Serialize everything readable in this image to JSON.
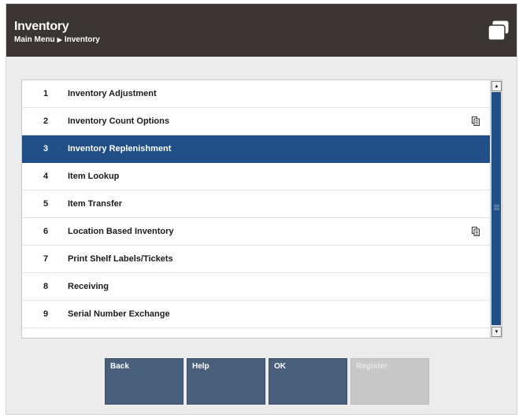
{
  "header": {
    "title": "Inventory",
    "breadcrumb": [
      "Main Menu",
      "Inventory"
    ],
    "breadcrumb_separator": "▶"
  },
  "menu": {
    "items": [
      {
        "num": "1",
        "label": "Inventory Adjustment",
        "icon": null
      },
      {
        "num": "2",
        "label": "Inventory Count Options",
        "icon": "document-copy-icon"
      },
      {
        "num": "3",
        "label": "Inventory Replenishment",
        "icon": null,
        "selected": true
      },
      {
        "num": "4",
        "label": "Item Lookup",
        "icon": null
      },
      {
        "num": "5",
        "label": "Item Transfer",
        "icon": null
      },
      {
        "num": "6",
        "label": "Location Based Inventory",
        "icon": "document-copy-icon"
      },
      {
        "num": "7",
        "label": "Print Shelf Labels/Tickets",
        "icon": null
      },
      {
        "num": "8",
        "label": "Receiving",
        "icon": null
      },
      {
        "num": "9",
        "label": "Serial Number Exchange",
        "icon": null
      }
    ]
  },
  "buttons": {
    "back": "Back",
    "help": "Help",
    "ok": "OK",
    "register": "Register"
  },
  "colors": {
    "header_bg": "#3a3532",
    "selected_bg": "#1f4f86",
    "button_bg": "#4a5f7c",
    "button_disabled_bg": "#c8c8c8"
  }
}
